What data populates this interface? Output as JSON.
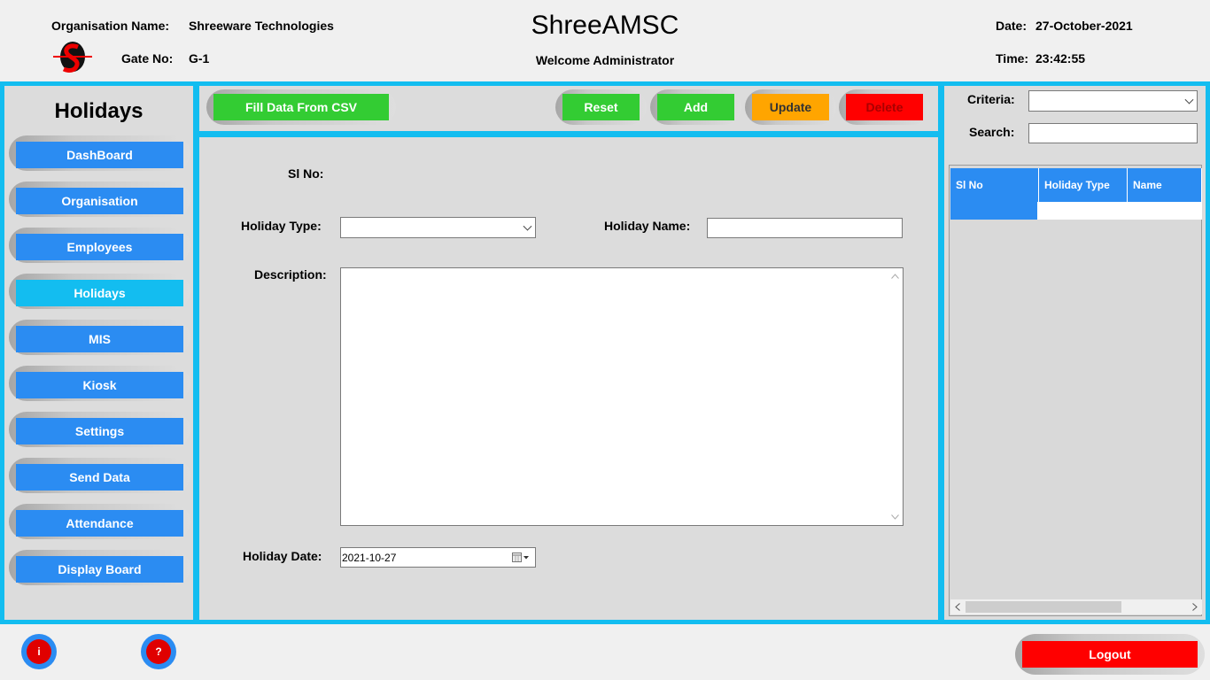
{
  "header": {
    "org_label": "Organisation Name:",
    "org_value": "Shreeware Technologies",
    "gate_label": "Gate No:",
    "gate_value": "G-1",
    "app_title": "ShreeAMSC",
    "welcome": "Welcome Administrator",
    "date_label": "Date:",
    "date_value": "27-October-2021",
    "time_label": "Time:",
    "time_value": "23:42:55",
    "logo_icon": "shreeware-logo-icon"
  },
  "nav": {
    "title": "Holidays",
    "items": [
      {
        "label": "DashBoard"
      },
      {
        "label": "Organisation"
      },
      {
        "label": "Employees"
      },
      {
        "label": "Holidays"
      },
      {
        "label": "MIS"
      },
      {
        "label": "Kiosk"
      },
      {
        "label": "Settings"
      },
      {
        "label": "Send Data"
      },
      {
        "label": "Attendance"
      },
      {
        "label": "Display Board"
      }
    ],
    "active_index": 3,
    "button_color": "#2b8cf2",
    "active_color": "#13bdf0"
  },
  "toolbar": {
    "fill_csv": "Fill Data From CSV",
    "reset": "Reset",
    "add": "Add",
    "update": "Update",
    "delete": "Delete"
  },
  "form": {
    "sl_no_label": "Sl No:",
    "holiday_type_label": "Holiday Type:",
    "holiday_type_value": "",
    "holiday_name_label": "Holiday Name:",
    "holiday_name_value": "",
    "description_label": "Description:",
    "description_value": "",
    "holiday_date_label": "Holiday Date:",
    "holiday_date_value": "2021-10-27"
  },
  "search_panel": {
    "criteria_label": "Criteria:",
    "criteria_value": "",
    "search_label": "Search:",
    "search_value": ""
  },
  "grid": {
    "columns": [
      "Sl No",
      "Holiday Type",
      "Name"
    ],
    "rows": [
      [
        "",
        "",
        ""
      ]
    ]
  },
  "footer": {
    "info_icon_text": "i",
    "help_icon_text": "?",
    "logout": "Logout"
  },
  "colors": {
    "accent": "#13bdf0",
    "green": "#33cc33",
    "orange": "#ffa500",
    "red": "#ff0000"
  }
}
